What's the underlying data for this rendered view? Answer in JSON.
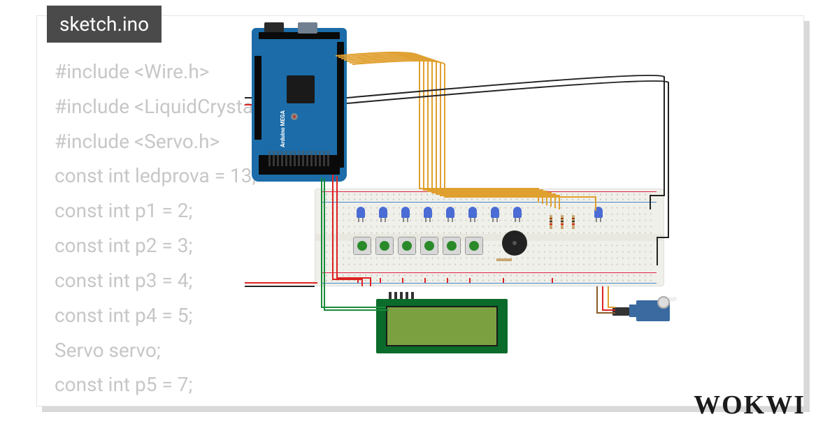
{
  "tab": {
    "label": "sketch.ino"
  },
  "code": {
    "lines": [
      "#include <Wire.h>",
      "#include <LiquidCrystal_I2C.h>",
      "#include <Servo.h>",
      "const int ledprova = 13;",
      "const int p1 = 2;",
      "const int p2 = 3;",
      "const int p3 = 4;",
      "const int p4 = 5;",
      "Servo servo;",
      "const int p5 = 7;"
    ]
  },
  "board": {
    "name": "Arduino MEGA"
  },
  "brand": "WOKWI"
}
